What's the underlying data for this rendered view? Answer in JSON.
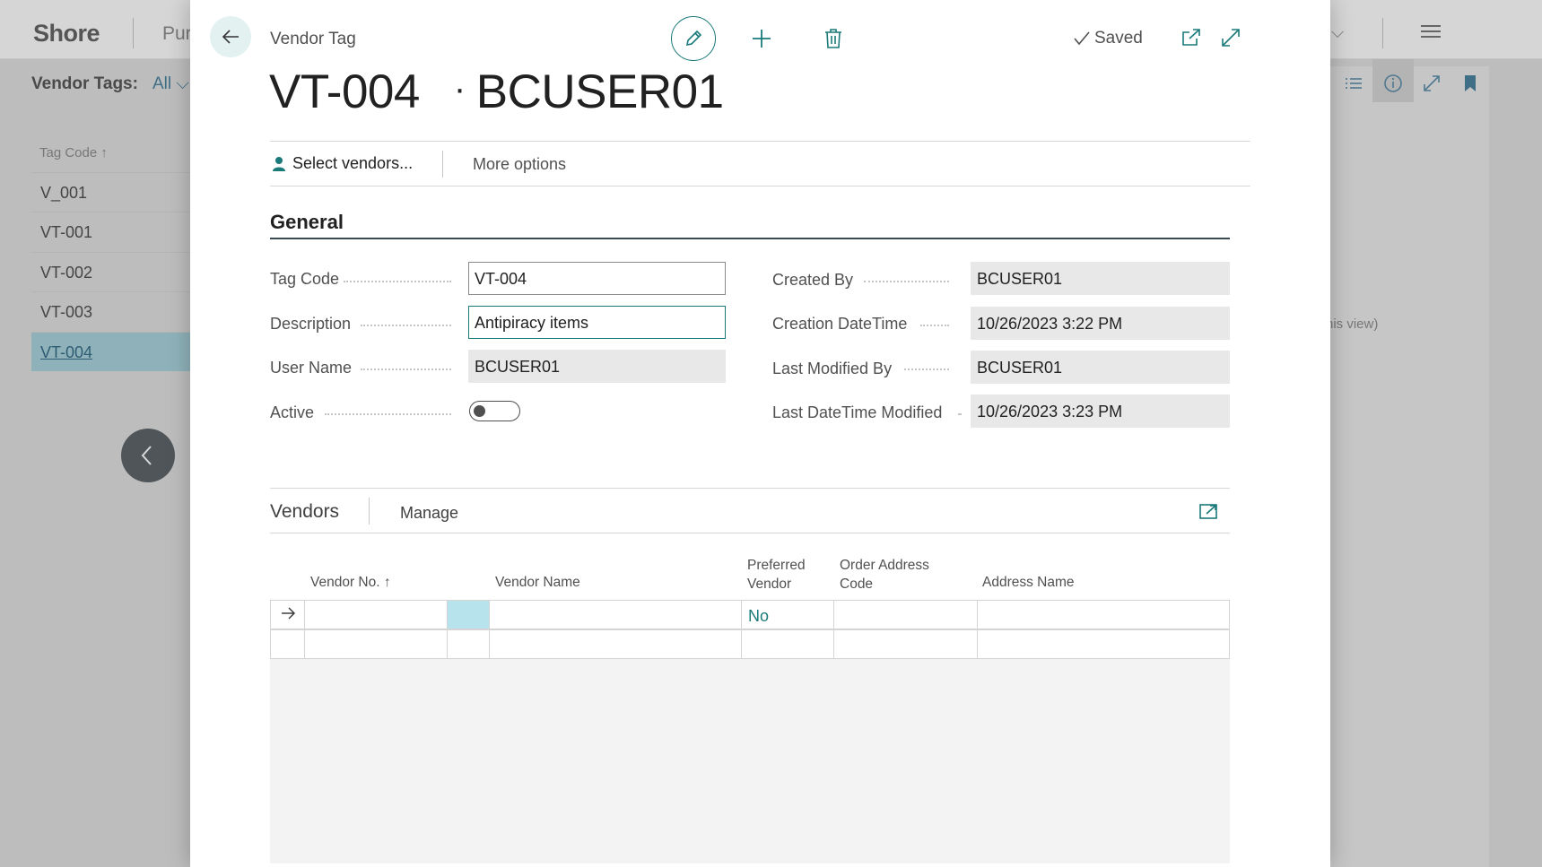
{
  "background": {
    "brand": "Shore",
    "nav_partial": "Pur",
    "nav_right_partial": "e",
    "filter_label": "Vendor Tags:",
    "filter_value": "All",
    "list_header": "Tag Code ↑",
    "list_rows": [
      "V_001",
      "VT-001",
      "VT-002",
      "VT-003",
      "VT-004"
    ],
    "view_text": "his view)"
  },
  "modal": {
    "page_type": "Vendor Tag",
    "saved_status": "Saved",
    "title_code": "VT-004",
    "title_dot": "·",
    "title_user": "BCUSER01",
    "actions": {
      "select_vendors": "Select vendors...",
      "more_options": "More options"
    },
    "general": {
      "header": "General",
      "tag_code_label": "Tag Code",
      "tag_code_value": "VT-004",
      "description_label": "Description",
      "description_value": "Antipiracy items",
      "user_name_label": "User Name",
      "user_name_value": "BCUSER01",
      "active_label": "Active",
      "active_value": false,
      "created_by_label": "Created By",
      "created_by_value": "BCUSER01",
      "creation_datetime_label": "Creation DateTime",
      "creation_datetime_value": "10/26/2023 3:22 PM",
      "last_modified_by_label": "Last Modified By",
      "last_modified_by_value": "BCUSER01",
      "last_datetime_modified_label": "Last DateTime Modified",
      "last_datetime_modified_value": "10/26/2023 3:23 PM"
    },
    "vendors": {
      "title": "Vendors",
      "manage": "Manage",
      "columns": {
        "vendor_no": "Vendor No. ↑",
        "vendor_name": "Vendor Name",
        "preferred_vendor_1": "Preferred",
        "preferred_vendor_2": "Vendor",
        "order_address_code_1": "Order Address",
        "order_address_code_2": "Code",
        "address_name": "Address Name"
      },
      "rows": [
        {
          "vendor_no": "",
          "vendor_name": "",
          "preferred_vendor": "No",
          "order_address_code": "",
          "address_name": ""
        }
      ]
    }
  },
  "colors": {
    "accent": "#1a7a7a",
    "selection": "#b7e3ec",
    "header_rule": "#3a4a55"
  }
}
